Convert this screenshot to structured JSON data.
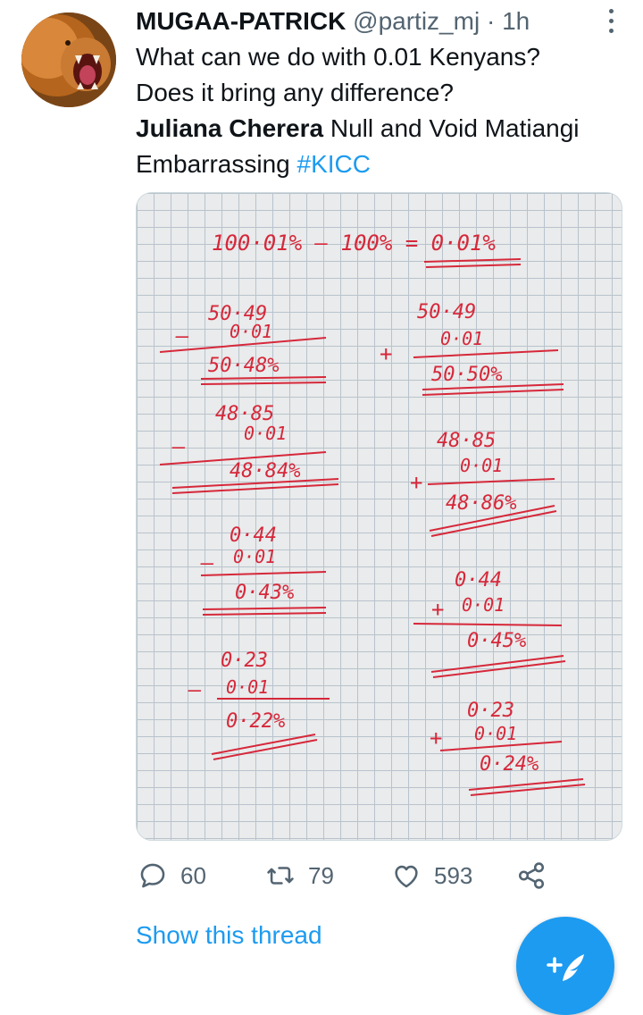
{
  "tweet": {
    "display_name": "MUGAA-PATRICK",
    "handle": "@partiz_mj",
    "separator": "·",
    "time": "1h",
    "line1": "What can we do with 0.01 Kenyans?",
    "line2": "Does it bring any difference?",
    "mention_bold": "Juliana Cherera",
    "line3_rest": " Null and Void Matiangi",
    "line4": "Embarrassing ",
    "hashtag": "#KICC"
  },
  "media": {
    "handwriting": {
      "header": "100·01% – 100% = 0·01%",
      "left": [
        {
          "a": "50·49",
          "b": "0·01",
          "op": "–",
          "r": "50·48%"
        },
        {
          "a": "48·85",
          "b": "0·01",
          "op": "–",
          "r": "48·84%"
        },
        {
          "a": "0·44",
          "b": "0·01",
          "op": "–",
          "r": "0·43%"
        },
        {
          "a": "0·23",
          "b": "0·01",
          "op": "–",
          "r": "0·22%"
        }
      ],
      "right": [
        {
          "a": "50·49",
          "b": "0·01",
          "op": "+",
          "r": "50·50%"
        },
        {
          "a": "48·85",
          "b": "0·01",
          "op": "+",
          "r": "48·86%"
        },
        {
          "a": "0·44",
          "b": "0·01",
          "op": "+",
          "r": "0·45%"
        },
        {
          "a": "0·23",
          "b": "0·01",
          "op": "+",
          "r": "0·24%"
        }
      ]
    }
  },
  "actions": {
    "replies": "60",
    "retweets": "79",
    "likes": "593"
  },
  "show_thread": "Show this thread",
  "colors": {
    "accent": "#1d9bf0",
    "muted": "#536471",
    "ink": "#d6283a"
  },
  "icons": [
    "lion-avatar",
    "more-icon",
    "reply-icon",
    "retweet-icon",
    "like-icon",
    "share-icon",
    "compose-icon"
  ]
}
